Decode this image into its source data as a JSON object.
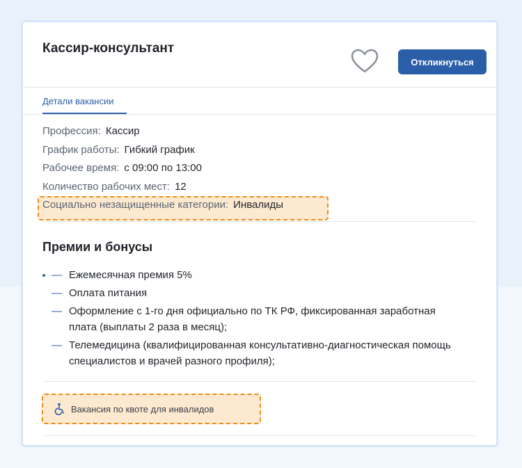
{
  "vacancy": {
    "title": "Кассир-консультант",
    "apply_label": "Откликнуться"
  },
  "tabs": [
    {
      "label": "Детали вакансии",
      "active": true
    }
  ],
  "details": [
    {
      "label": "Профессия:",
      "value": "Кассир"
    },
    {
      "label": "График работы:",
      "value": "Гибкий график"
    },
    {
      "label": "Рабочее время:",
      "value": "с 09:00 по 13:00"
    },
    {
      "label": "Количество рабочих мест:",
      "value": "12"
    },
    {
      "label": "Социально незащищенные категории:",
      "value": "Инвалиды"
    }
  ],
  "bonuses": {
    "heading": "Премии и бонусы",
    "items": [
      "Ежемесячная премия 5%",
      "Оплата питания",
      "Оформление с 1-го дня официально по ТК РФ, фиксированная заработная плата (выплаты 2 раза в месяц);",
      "Телемедицина (квалифицированная консультативно-диагностическая помощь специалистов и врачей разного профиля);"
    ]
  },
  "quota_badge": {
    "label": "Вакансия по квоте для инвалидов",
    "icon": "wheelchair-icon"
  },
  "colors": {
    "accent": "#2a5ea8",
    "highlight_border": "#ec8c1a",
    "highlight_fill": "#fde9d0"
  }
}
